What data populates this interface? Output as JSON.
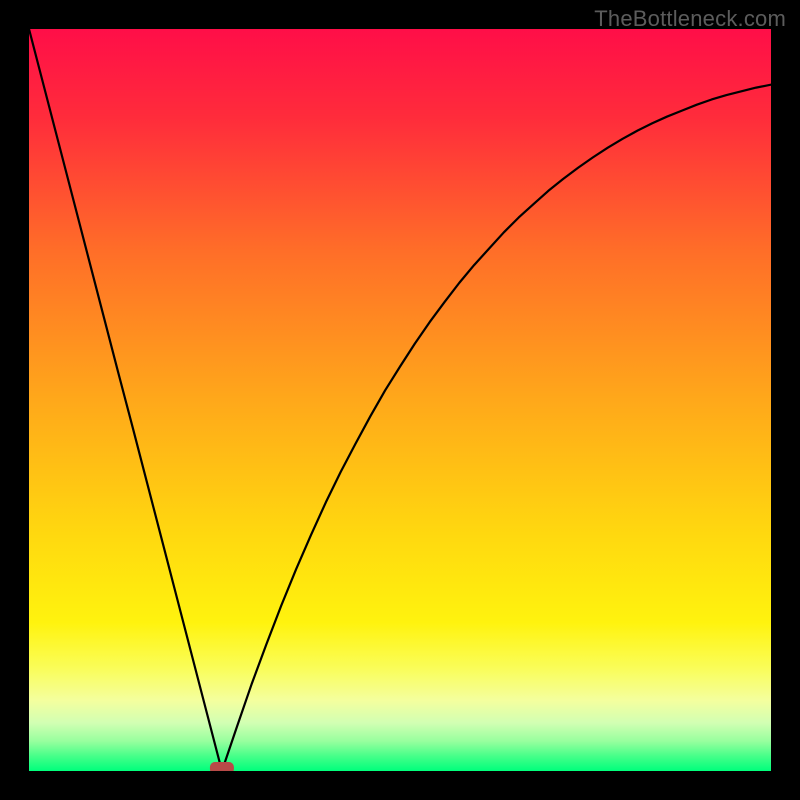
{
  "watermark": {
    "text": "TheBottleneck.com"
  },
  "chart_data": {
    "type": "line",
    "title": "",
    "xlabel": "",
    "ylabel": "",
    "xlim": [
      0,
      100
    ],
    "ylim": [
      0,
      100
    ],
    "x": [
      0,
      2,
      4,
      6,
      8,
      10,
      12,
      14,
      16,
      18,
      20,
      22,
      24,
      26,
      28,
      30,
      32,
      34,
      36,
      38,
      40,
      42,
      44,
      46,
      48,
      50,
      52,
      54,
      56,
      58,
      60,
      62,
      64,
      66,
      68,
      70,
      72,
      74,
      76,
      78,
      80,
      82,
      84,
      86,
      88,
      90,
      92,
      94,
      96,
      98,
      100
    ],
    "values": [
      100,
      92.3,
      84.6,
      76.9,
      69.2,
      61.5,
      53.8,
      46.2,
      38.5,
      30.8,
      23.1,
      15.4,
      7.7,
      0,
      5.9,
      11.7,
      17.1,
      22.3,
      27.2,
      31.8,
      36.2,
      40.3,
      44.1,
      47.8,
      51.3,
      54.5,
      57.6,
      60.5,
      63.2,
      65.8,
      68.2,
      70.4,
      72.6,
      74.6,
      76.4,
      78.2,
      79.8,
      81.3,
      82.7,
      84.0,
      85.2,
      86.3,
      87.3,
      88.2,
      89.0,
      89.8,
      90.5,
      91.1,
      91.6,
      92.1,
      92.5
    ],
    "minimum_x": 26,
    "marker": {
      "x": 26,
      "y": 0,
      "shape": "rounded-rect",
      "color": "#b84a48"
    },
    "background_gradient": {
      "stops": [
        {
          "pos": 0.0,
          "color": "#ff0e48"
        },
        {
          "pos": 0.12,
          "color": "#ff2c3b"
        },
        {
          "pos": 0.3,
          "color": "#ff6e28"
        },
        {
          "pos": 0.5,
          "color": "#ffa81a"
        },
        {
          "pos": 0.68,
          "color": "#ffd80f"
        },
        {
          "pos": 0.8,
          "color": "#fff30e"
        },
        {
          "pos": 0.86,
          "color": "#fafd57"
        },
        {
          "pos": 0.905,
          "color": "#f4ff9e"
        },
        {
          "pos": 0.935,
          "color": "#d2ffb3"
        },
        {
          "pos": 0.96,
          "color": "#97ff9e"
        },
        {
          "pos": 0.98,
          "color": "#46ff89"
        },
        {
          "pos": 1.0,
          "color": "#00ff7c"
        }
      ]
    }
  }
}
